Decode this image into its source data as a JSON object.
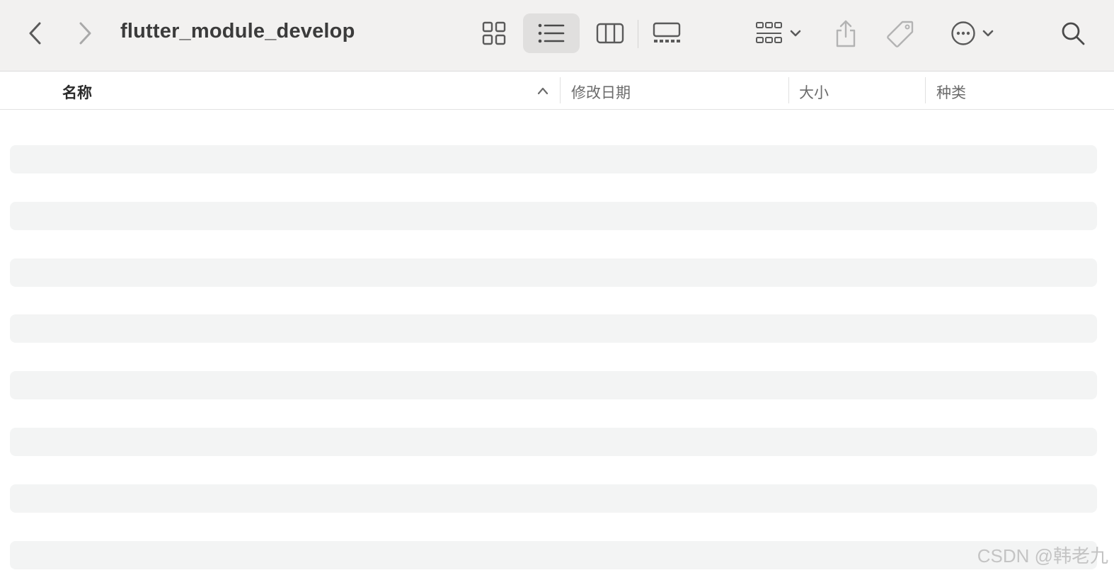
{
  "window": {
    "title": "flutter_module_develop"
  },
  "toolbar": {
    "back_icon": "chevron-left-icon",
    "forward_icon": "chevron-right-icon",
    "view_modes": [
      "icon-view",
      "list-view",
      "column-view",
      "gallery-view"
    ],
    "active_view": "list-view",
    "group_icon": "group-grid-icon",
    "share_icon": "share-icon",
    "tag_icon": "tag-icon",
    "more_icon": "ellipsis-circle-icon",
    "search_icon": "search-icon"
  },
  "columns": {
    "name": "名称",
    "modified": "修改日期",
    "size": "大小",
    "kind": "种类",
    "sort_icon": "chevron-up-icon"
  },
  "rows_count_visible": 8,
  "watermark": "CSDN @韩老九",
  "colors": {
    "toolbar_bg": "#f2f1f0",
    "row_stripe": "#f3f4f4",
    "active_view_bg": "#e0dfde"
  }
}
